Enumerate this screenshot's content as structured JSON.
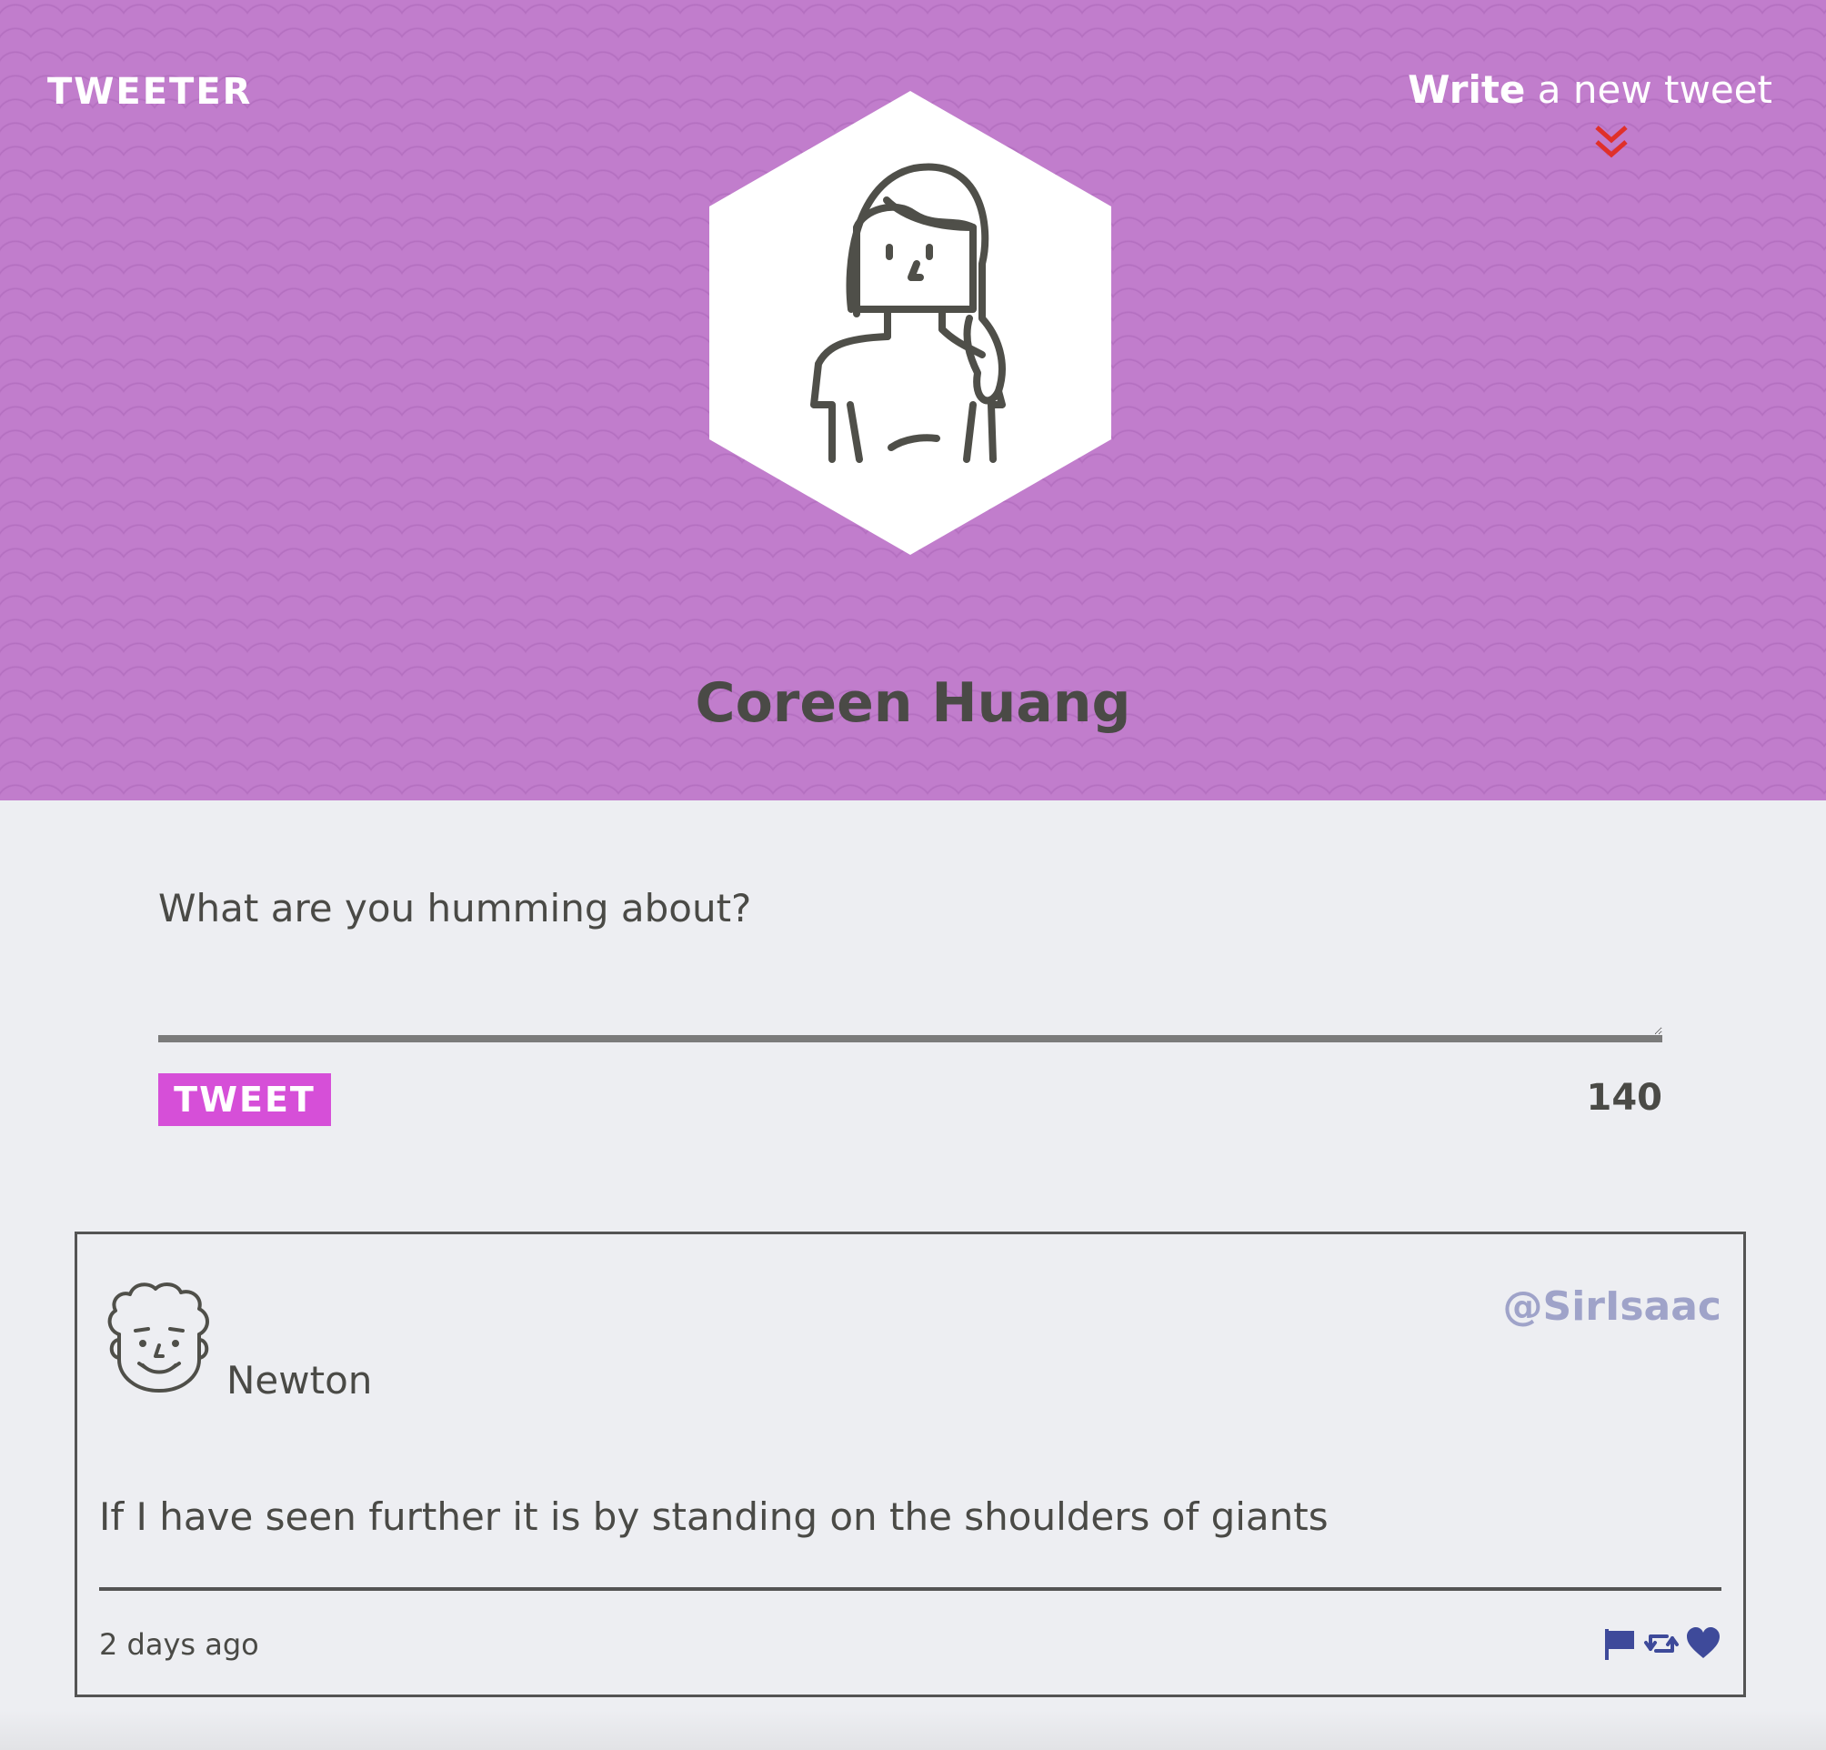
{
  "header": {
    "brand": "TWEETER",
    "compose_link_bold": "Write",
    "compose_link_rest": " a new tweet",
    "chevron_icon": "double-chevron-down-icon",
    "profile_name": "Coreen Huang",
    "avatar_icon": "woman-avatar-icon"
  },
  "composer": {
    "placeholder": "What are you humming about?",
    "value": "",
    "tweet_button_label": "TWEET",
    "char_count": "140"
  },
  "tweets": [
    {
      "avatar_icon": "curly-hair-man-avatar-icon",
      "author": "Newton",
      "handle": "@SirIsaac",
      "body": "If I have seen further it is by standing on the shoulders of giants",
      "time": "2 days ago",
      "actions": [
        "flag-icon",
        "retweet-icon",
        "heart-icon"
      ]
    }
  ],
  "colors": {
    "header_bg": "#c17dcc",
    "page_bg": "#edeef2",
    "tweet_button": "#d64fd8",
    "chevron": "#e0302a",
    "handle": "#9fa3c9",
    "action_icons": "#3e4a9a",
    "text": "#4a4a46"
  }
}
